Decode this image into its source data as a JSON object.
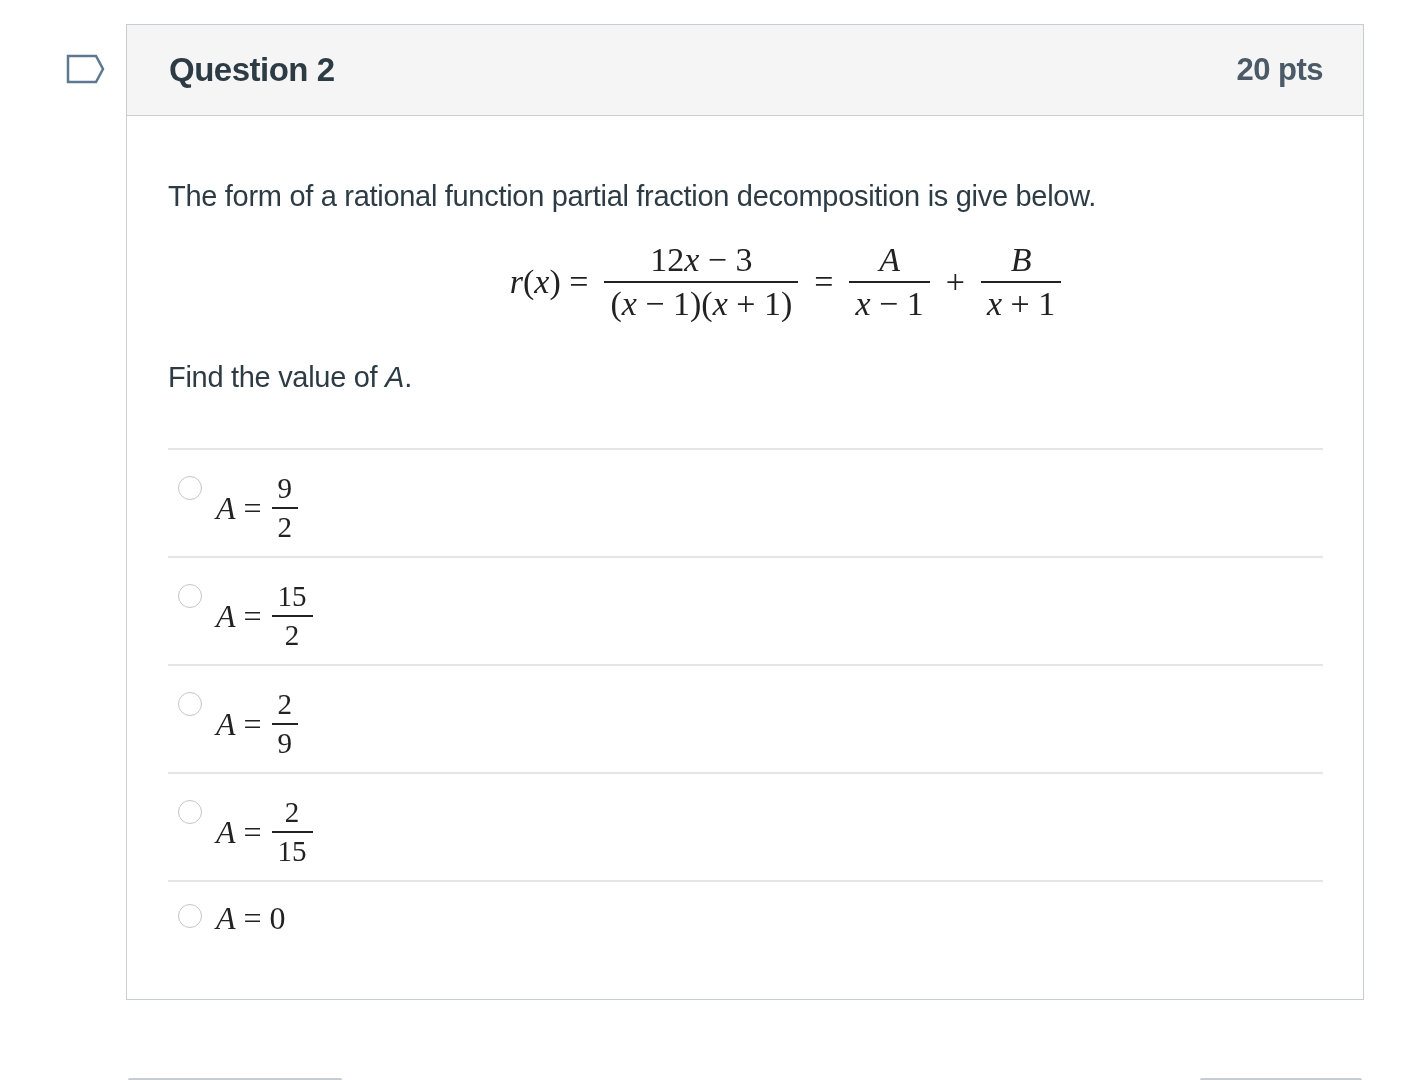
{
  "question": {
    "title": "Question 2",
    "points": "20 pts",
    "flagged": false
  },
  "intro": "The form of a rational function partial fraction decomposition is give below.",
  "formula": [
    {
      "kind": "text",
      "text": "*r*(*x*) ="
    },
    {
      "kind": "fraction",
      "numerator": "12x − 3",
      "denominator": "(*x* − 1)(*x* + 1)"
    },
    {
      "kind": "text",
      "text": "="
    },
    {
      "kind": "fraction",
      "numerator": "*A*",
      "denominator": "*x* − 1"
    },
    {
      "kind": "text",
      "text": "+"
    },
    {
      "kind": "fraction",
      "numerator": "*B*",
      "denominator": "*x* + 1"
    }
  ],
  "prompt": "Find the value of *A*.",
  "answers": [
    {
      "kind": "fraction",
      "lhs": "*A* =",
      "numerator": "9",
      "denominator": "2",
      "selected": false
    },
    {
      "kind": "fraction",
      "lhs": "*A* =",
      "numerator": "15",
      "denominator": "2",
      "selected": false
    },
    {
      "kind": "fraction",
      "lhs": "*A* =",
      "numerator": "2",
      "denominator": "9",
      "selected": false
    },
    {
      "kind": "fraction",
      "lhs": "*A* =",
      "numerator": "2",
      "denominator": "15",
      "selected": false
    },
    {
      "kind": "plain",
      "lhs": "*A* = 0",
      "selected": false
    }
  ]
}
